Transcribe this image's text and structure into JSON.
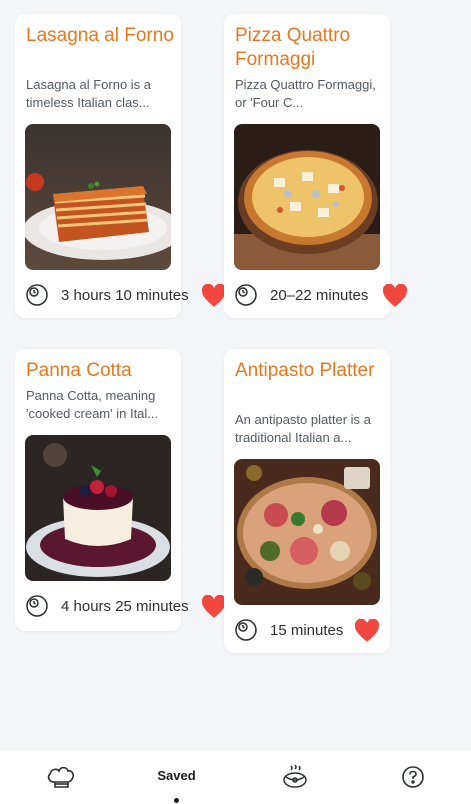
{
  "recipes": [
    {
      "title": "Lasagna al Forno",
      "description": "Lasagna al Forno is a timeless Italian clas...",
      "time": "3 hours 10 minutes",
      "image": "lasagna-photo",
      "favorite": true
    },
    {
      "title": "Pizza Quattro Formaggi",
      "description": "Pizza Quattro Formaggi, or 'Four C...",
      "time": "20–22 minutes",
      "image": "pizza-photo",
      "favorite": true
    },
    {
      "title": "Panna Cotta",
      "description": "Panna Cotta, meaning 'cooked cream' in Ital...",
      "time": "4 hours 25 minutes",
      "image": "panna-cotta-photo",
      "favorite": true
    },
    {
      "title": "Antipasto Platter",
      "description": "An antipasto platter is a traditional Italian a...",
      "time": "15 minutes",
      "image": "antipasto-photo",
      "favorite": true
    }
  ],
  "nav": {
    "items": [
      {
        "icon": "chef-hat-icon"
      },
      {
        "label": "Saved",
        "active": true
      },
      {
        "icon": "cooking-pot-icon"
      },
      {
        "icon": "help-icon"
      }
    ]
  },
  "colors": {
    "accent": "#e8781f",
    "heart": "#f0473e",
    "background": "#f4f5f9"
  }
}
